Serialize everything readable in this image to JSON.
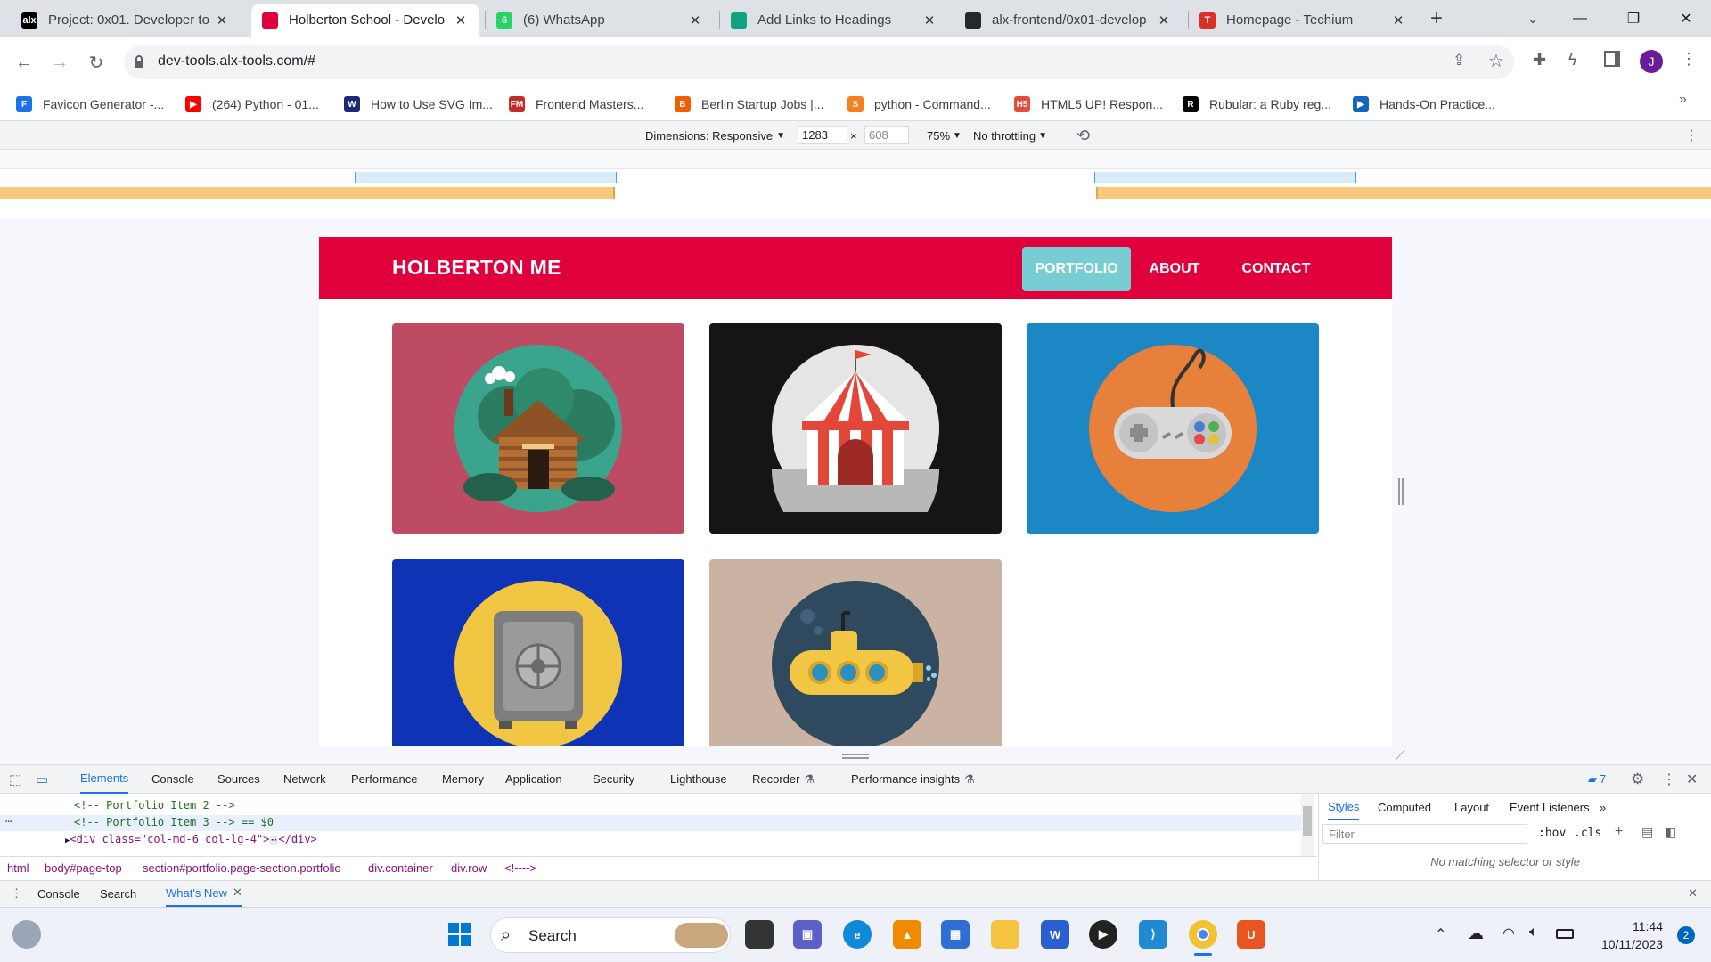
{
  "tabs": [
    {
      "title": "Project: 0x01. Developer to",
      "icon": "alx-icon",
      "color": "#000000",
      "fav": "alx"
    },
    {
      "title": "Holberton School - Develo",
      "icon": "holberton-icon",
      "color": "#e0003c",
      "fav": ""
    },
    {
      "title": "(6) WhatsApp",
      "icon": "whatsapp-icon",
      "color": "#25d366",
      "fav": "6"
    },
    {
      "title": "Add Links to Headings",
      "icon": "chatgpt-icon",
      "color": "#10a37f",
      "fav": ""
    },
    {
      "title": "alx-frontend/0x01-develop",
      "icon": "github-icon",
      "color": "#24292e",
      "fav": ""
    },
    {
      "title": "Homepage - Techium",
      "icon": "techium-icon",
      "color": "#d93025",
      "fav": "T"
    }
  ],
  "address": {
    "url": "dev-tools.alx-tools.com/#"
  },
  "bookmarks": [
    {
      "label": "Favicon Generator -...",
      "icon": "favicon-generator-icon",
      "color": "#1a73e8",
      "glyph": "F"
    },
    {
      "label": "(264) Python - 01...",
      "icon": "youtube-icon",
      "color": "#ff0000",
      "glyph": "▶"
    },
    {
      "label": "How to Use SVG Im...",
      "icon": "svg-site-icon",
      "color": "#1e2a78",
      "glyph": "W"
    },
    {
      "label": "Frontend Masters...",
      "icon": "frontend-masters-icon",
      "color": "#c02d28",
      "glyph": "FM"
    },
    {
      "label": "Berlin Startup Jobs |...",
      "icon": "berlin-startup-jobs-icon",
      "color": "#f25c05",
      "glyph": "B"
    },
    {
      "label": "python - Command...",
      "icon": "stackoverflow-icon",
      "color": "#f48024",
      "glyph": "S"
    },
    {
      "label": "HTML5 UP! Respon...",
      "icon": "html5up-icon",
      "color": "#e44d3a",
      "glyph": "H5"
    },
    {
      "label": "Rubular: a Ruby reg...",
      "icon": "rubular-icon",
      "color": "#000000",
      "glyph": "R"
    },
    {
      "label": "Hands-On Practice...",
      "icon": "hands-on-icon",
      "color": "#1565c0",
      "glyph": "▶"
    }
  ],
  "device_toolbar": {
    "dimensions": "Dimensions: Responsive",
    "width": "1283",
    "height": "608",
    "zoom": "75%",
    "throttling": "No throttling",
    "times": "×"
  },
  "site": {
    "brand": "HOLBERTON ME",
    "nav": [
      {
        "label": "PORTFOLIO",
        "active": true
      },
      {
        "label": "ABOUT",
        "active": false
      },
      {
        "label": "CONTACT",
        "active": false
      }
    ],
    "portfolio": [
      {
        "name": "cabin",
        "bg": "#bd4b64",
        "icon": "cabin-icon"
      },
      {
        "name": "circus",
        "bg": "#161415",
        "icon": "circus-tent-icon"
      },
      {
        "name": "game",
        "bg": "#1b87c5",
        "icon": "game-controller-icon"
      },
      {
        "name": "safe",
        "bg": "#0f33b5",
        "icon": "safe-icon"
      },
      {
        "name": "submarine",
        "bg": "#cbb3a3",
        "icon": "submarine-icon"
      }
    ]
  },
  "devtools": {
    "tabs": [
      "Elements",
      "Console",
      "Sources",
      "Network",
      "Performance",
      "Memory",
      "Application",
      "Security",
      "Lighthouse",
      "Recorder",
      "Performance insights"
    ],
    "issues_count": "7",
    "code": [
      "<!-- Portfolio Item 2 -->",
      "<!-- Portfolio Item 3 --> == $0",
      "<div class=\"col-md-6 col-lg-4\">",
      "</div>"
    ],
    "breadcrumbs": [
      "html",
      "body#page-top",
      "section#portfolio.page-section.portfolio",
      "div.container",
      "div.row",
      "<!---->"
    ],
    "styles_tabs": [
      "Styles",
      "Computed",
      "Layout",
      "Event Listeners"
    ],
    "filter_placeholder": "Filter",
    "hov": ":hov",
    "cls": ".cls",
    "no_match": "No matching selector or style",
    "drawer_tabs": [
      "Console",
      "Search",
      "What's New"
    ]
  },
  "taskbar": {
    "search": "Search",
    "time": "11:44",
    "date": "10/11/2023",
    "notifications": "2"
  }
}
